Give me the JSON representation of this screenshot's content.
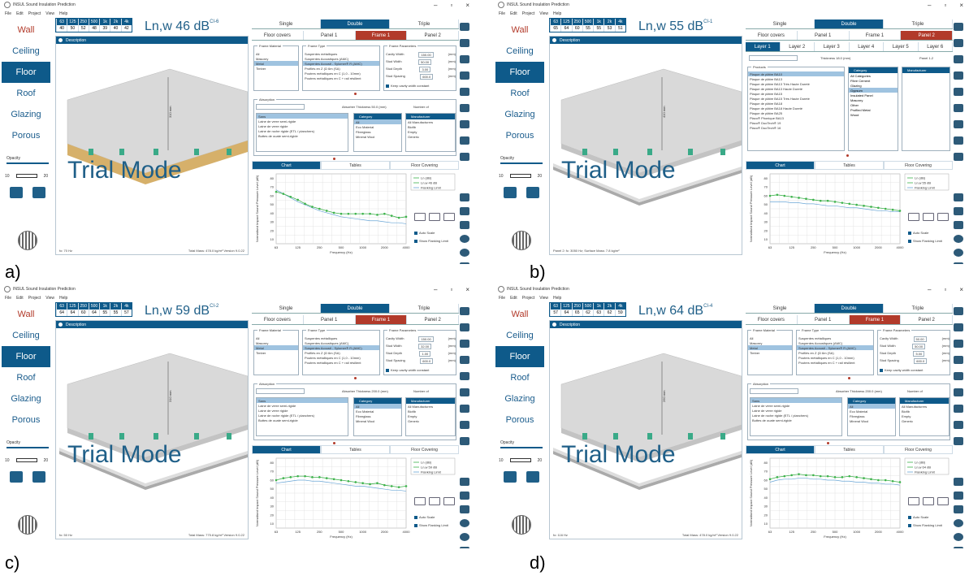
{
  "app": {
    "title": "INSUL Sound Insulation Prediction",
    "menu": [
      "File",
      "Edit",
      "Project",
      "View",
      "Help"
    ],
    "window_buttons": [
      "–",
      "▫",
      "×"
    ]
  },
  "nav": [
    "Wall",
    "Ceiling",
    "Floor",
    "Roof",
    "Glazing",
    "Porous"
  ],
  "opacity_label": "Opacity",
  "opacity_ticks": [
    "10",
    "20"
  ],
  "trial_mode": "Trial Mode",
  "description_label": "Description",
  "top_tabs": [
    "Single",
    "Double",
    "Triple"
  ],
  "chart_tabs": [
    "Chart",
    "Tables",
    "Floor Covering"
  ],
  "chart_legend": [
    "Ln (dB)",
    "Ln,w 46 dB",
    "Flanking Limit"
  ],
  "chart_ylabel": "Normalised Impact Sound Pressure Level (dB)",
  "chart_xlabel": "Frequency (Hz)",
  "chart_xticks": [
    "63",
    "125",
    "250",
    "500",
    "1000",
    "2000",
    "4000"
  ],
  "chart_yticks": [
    "10",
    "20",
    "30",
    "40",
    "50",
    "60",
    "70",
    "80"
  ],
  "auto_scale": "Auto Scale",
  "show_flanking": "Show Flanking Limit",
  "panels": [
    {
      "label": "a)",
      "rating": "Ln,w 46 dB",
      "ci": "CI-6",
      "freq_headers": [
        "63",
        "125",
        "250",
        "500",
        "1k",
        "2k",
        "4k"
      ],
      "freq_values": [
        "40",
        "50",
        "52",
        "48",
        "39",
        "40",
        "42"
      ],
      "sub_tabs": [
        "Floor covers",
        "Panel 1",
        "Frame 1",
        "Panel 2"
      ],
      "frame_material": [
        "All",
        "Masonry",
        "Metal",
        "Timber"
      ],
      "frame_type": [
        "Suspentes métalliques",
        "Suspentes Acoustiques (AMC)",
        "Suspentes Acousti - Sylomer® R (AMC)",
        "Profilés en Z (Ω 6m (SA)",
        "Poutres métalliques en C (1,0 - 10mm)",
        "Poutres métalliques en C + rail résilient"
      ],
      "frame_params": [
        [
          "Cavity Width",
          "150.00",
          "(mm)"
        ],
        [
          "Stud Width",
          "50.00",
          "(mm)"
        ],
        [
          "Stud Depth",
          "3.00",
          "(mm)"
        ],
        [
          "Stud Spacing",
          "600.0",
          "(mm)"
        ]
      ],
      "keep_cavity": "Keep cavity width constant",
      "absorption": "Absorption",
      "absorber_thickness": "Absorber Thickness 50.0 (mm)",
      "number_of": "Number of",
      "products": [
        "Sans",
        "Laine de verre semi-rigide",
        "Laine de verre rigide",
        "Laine de roche rigide (ETL / planchers)",
        "Buttes de ouate semi-rigide"
      ],
      "category": [
        "All",
        "Eco Material",
        "Fibreglass",
        "Mineral Wool"
      ],
      "manufacturer": [
        "All Manufacturers",
        "Biofib",
        "Empty",
        "Generic"
      ],
      "footer_left": "fo: 70 Hz",
      "footer_right": "Total Mass: 478.0 kg/m²  Version 9.0.22",
      "dim": "310 mm",
      "ln": [
        62,
        60,
        57,
        54,
        50,
        47,
        45,
        43,
        41,
        40,
        40,
        40,
        40,
        40,
        39,
        40,
        38,
        36,
        37
      ],
      "flank": [
        64,
        60,
        56,
        52,
        49,
        46,
        43,
        41,
        39,
        37,
        36,
        35,
        34,
        33,
        33,
        32,
        31,
        31,
        30
      ]
    },
    {
      "label": "b)",
      "rating": "Ln,w 55 dB",
      "ci": "CI-1",
      "freq_headers": [
        "63",
        "125",
        "250",
        "500",
        "1k",
        "2k",
        "4k"
      ],
      "freq_values": [
        "65",
        "64",
        "60",
        "55",
        "55",
        "53",
        "51"
      ],
      "sub_tabs": [
        "Floor covers",
        "Panel 1",
        "Frame 1",
        "Panel 2"
      ],
      "layers": [
        "Layer 1",
        "Layer 2",
        "Layer 3",
        "Layer 4",
        "Layer 5",
        "Layer 6"
      ],
      "thickness": "Thickness 18.0 (mm)",
      "panel_of": "Panel 1-2",
      "products_title": "Products",
      "product_list": [
        "Plaque de plâtre BA10",
        "Plaque de plâtre BA13",
        "Plaque de plâtre BA13 Très Haute Dureté",
        "Plaque de plâtre BA13 Haute Dureté",
        "Plaque de plâtre BA15",
        "Plaque de plâtre BA15 Très Haute Dureté",
        "Plaque de plâtre BA18",
        "Plaque de plâtre BA18 Haute Dureté",
        "Plaque de plâtre BA25",
        "Placo® Phonique BA13",
        "Placo® DuoTech® 19",
        "Placo® DuoTech® 16"
      ],
      "categories_b": [
        "All Categories",
        "Fibre Cement",
        "Glazing",
        "Gypsum",
        "Insulated Panel",
        "Masonry",
        "Other",
        "Profiled Metal",
        "Wood"
      ],
      "footer_left": "Panel 2:  fc: 3050 Hz; Surface Mass: 7.8 kg/m²",
      "dim": "410 mm",
      "ln": [
        58,
        59,
        58,
        57,
        56,
        55,
        54,
        53,
        53,
        52,
        51,
        50,
        49,
        48,
        47,
        46,
        45,
        44,
        43
      ],
      "flank": [
        52,
        52,
        52,
        51,
        51,
        50,
        50,
        49,
        48,
        48,
        47,
        46,
        46,
        45,
        44,
        43,
        43,
        42,
        42
      ]
    },
    {
      "label": "c)",
      "rating": "Ln,w 59 dB",
      "ci": "CI-2",
      "freq_headers": [
        "63",
        "125",
        "250",
        "500",
        "1k",
        "2k",
        "4k"
      ],
      "freq_values": [
        "64",
        "64",
        "60",
        "64",
        "55",
        "55",
        "57"
      ],
      "sub_tabs": [
        "Floor covers",
        "Panel 1",
        "Frame 1",
        "Panel 2"
      ],
      "frame_params": [
        [
          "Cavity Width",
          "150.00",
          "(mm)"
        ],
        [
          "Stud Width",
          "32.00",
          "(mm)"
        ],
        [
          "Stud Depth",
          "1.00",
          "(mm)"
        ],
        [
          "Stud Spacing",
          "600.0",
          "(mm)"
        ]
      ],
      "absorber_thickness": "Absorber Thickness 200.0 (mm)",
      "footer_left": "fo: 50 Hz",
      "footer_right": "Total Mass: 775.8 kg/m²  Version 9.0.22",
      "dim": "310 mm",
      "ln": [
        58,
        60,
        61,
        62,
        62,
        61,
        61,
        60,
        59,
        58,
        57,
        56,
        55,
        54,
        55,
        53,
        52,
        51,
        52
      ],
      "flank": [
        55,
        56,
        57,
        58,
        58,
        57,
        57,
        56,
        55,
        54,
        53,
        52,
        52,
        51,
        50,
        49,
        48,
        48,
        47
      ]
    },
    {
      "label": "d)",
      "rating": "Ln,w 64 dB",
      "ci": "CI-4",
      "freq_headers": [
        "63",
        "125",
        "250",
        "500",
        "1k",
        "2k",
        "4k"
      ],
      "freq_values": [
        "57",
        "64",
        "65",
        "62",
        "63",
        "62",
        "59"
      ],
      "sub_tabs": [
        "Floor covers",
        "Panel 1",
        "Frame 1",
        "Panel 2"
      ],
      "frame_params": [
        [
          "Cavity Width",
          "50.00",
          "(mm)"
        ],
        [
          "Stud Width",
          "50.00",
          "(mm)"
        ],
        [
          "Stud Depth",
          "5.00",
          "(mm)"
        ],
        [
          "Stud Spacing",
          "600.0",
          "(mm)"
        ]
      ],
      "absorber_thickness": "Absorber Thickness 200.0 (mm)",
      "footer_left": "fo: 116 Hz",
      "footer_right": "Total Mass: 478.0 kg/m²  Version 9.0.22",
      "dim": "260 mm",
      "ln": [
        59,
        61,
        62,
        63,
        64,
        63,
        63,
        62,
        62,
        61,
        61,
        62,
        61,
        60,
        59,
        58,
        58,
        57,
        56
      ],
      "flank": [
        56,
        58,
        59,
        59,
        60,
        60,
        59,
        59,
        58,
        58,
        57,
        57,
        56,
        56,
        55,
        55,
        54,
        54,
        53
      ]
    }
  ]
}
